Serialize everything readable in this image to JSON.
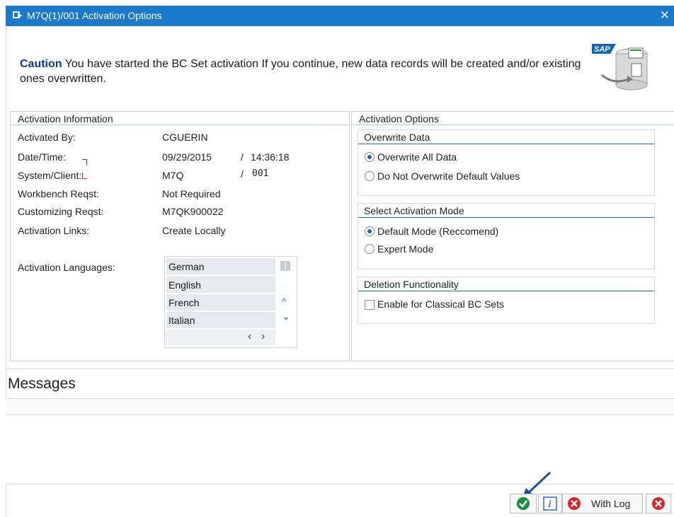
{
  "window": {
    "title": "M7Q(1)/001 Activation Options",
    "close_glyph": "✕"
  },
  "caution": {
    "strong": "Caution",
    "text": " You have started the BC Set activation If you continue, new data records will be created and/or existing ones overwritten."
  },
  "logo": {
    "text": "SAP"
  },
  "info": {
    "title": "Activation Information",
    "rows": [
      {
        "label": "Activated By:",
        "value": "CGUERIN"
      },
      {
        "label": "Date/Time:",
        "value": "09/29/2015",
        "sep": "/",
        "value2": "14:36:18"
      },
      {
        "label": "System/Client:",
        "value": "M7Q",
        "sep": "/",
        "value2": "001"
      },
      {
        "label": "Workbench Reqst:",
        "value": "Not Required"
      },
      {
        "label": "Customizing Reqst:",
        "value": "M7QK900022"
      },
      {
        "label": "Activation Links:",
        "value": "Create Locally"
      }
    ],
    "languages_label": "Activation Languages:",
    "languages": [
      "German",
      "English",
      "French",
      "Italian"
    ],
    "scroll_left": "‹",
    "scroll_right": "›",
    "scroll_up": "^",
    "scroll_down": "⌄"
  },
  "options": {
    "title": "Activation Options",
    "overwrite": {
      "title": "Overwrite Data",
      "opt1": "Overwrite All Data",
      "opt2": "Do Not Overwrite Default Values",
      "selected": "opt1"
    },
    "mode": {
      "title": "Select Activation Mode",
      "opt1": "Default Mode (Reccomend)",
      "opt2": "Expert Mode",
      "selected": "opt1"
    },
    "deletion": {
      "title": "Deletion Functionality",
      "check": "Enable for Classical BC Sets",
      "checked": false
    }
  },
  "messages": {
    "title": "Messages"
  },
  "footer": {
    "info_glyph": "i",
    "with_log": "With Log"
  },
  "colors": {
    "title_bar": "#1979ca",
    "accent_line": "#1f6fbf",
    "confirm_green": "#1a8f3c",
    "cancel_red": "#d9262a"
  }
}
